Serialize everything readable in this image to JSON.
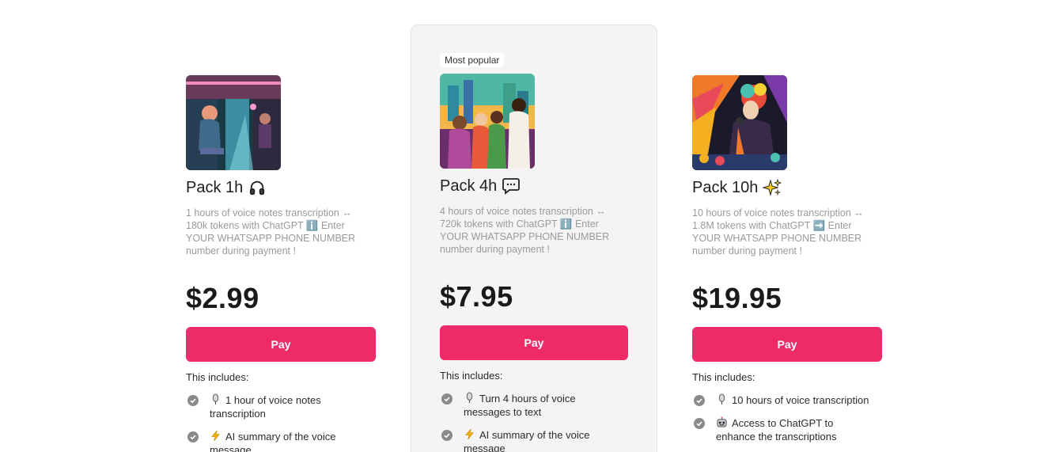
{
  "plans": [
    {
      "title": "Pack 1h",
      "icon": "headphones-icon",
      "description": "1 hours of voice notes transcription ↔ 180k tokens with ChatGPT ℹ️ Enter YOUR WHATSAPP PHONE NUMBER number during payment !",
      "price": "$2.99",
      "pay_label": "Pay",
      "includes_label": "This includes:",
      "features": [
        {
          "icon": "microphone-icon",
          "text": "1 hour of voice notes transcription"
        },
        {
          "icon": "lightning-icon",
          "text": "AI summary of the voice message"
        }
      ]
    },
    {
      "badge": "Most popular",
      "title": "Pack 4h",
      "icon": "speech-bubble-icon",
      "description": "4 hours of voice notes transcription ↔ 720k tokens with ChatGPT ℹ️ Enter YOUR WHATSAPP PHONE NUMBER number during payment !",
      "price": "$7.95",
      "pay_label": "Pay",
      "includes_label": "This includes:",
      "features": [
        {
          "icon": "microphone-icon",
          "text": "Turn 4 hours of voice messages to text"
        },
        {
          "icon": "lightning-icon",
          "text": "AI summary of the voice message"
        }
      ]
    },
    {
      "title": "Pack 10h",
      "icon": "sparkles-icon",
      "description": "10 hours of voice notes transcription ↔ 1.8M tokens with ChatGPT ➡️ Enter YOUR WHATSAPP PHONE NUMBER number during payment !",
      "price": "$19.95",
      "pay_label": "Pay",
      "includes_label": "This includes:",
      "features": [
        {
          "icon": "microphone-icon",
          "text": "10 hours of voice transcription"
        },
        {
          "icon": "robot-icon",
          "text": "Access to ChatGPT to enhance the transcriptions"
        }
      ]
    }
  ],
  "colors": {
    "accent": "#ee2a68",
    "featured_bg": "#f4f4f5",
    "muted_text": "#9a9a9a",
    "check": "#8a8a8a"
  }
}
